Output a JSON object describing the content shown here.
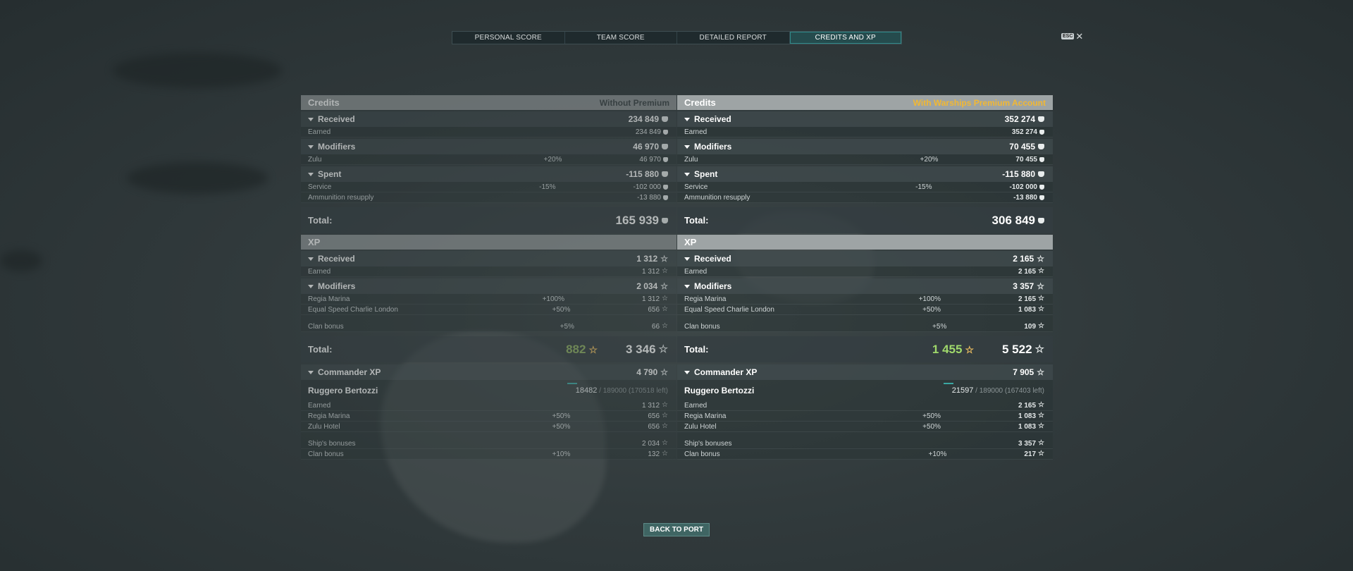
{
  "tabs": [
    "PERSONAL SCORE",
    "TEAM SCORE",
    "DETAILED REPORT",
    "CREDITS AND XP"
  ],
  "esc": {
    "key": "ESC",
    "close": "✕"
  },
  "left": {
    "credits_title": "Credits",
    "credits_note": "Without Premium",
    "received": "Received",
    "received_val": "234 849",
    "earned": "Earned",
    "earned_val": "234 849",
    "modifiers": "Modifiers",
    "modifiers_val": "46 970",
    "zulu": "Zulu",
    "zulu_pct": "+20%",
    "zulu_val": "46 970",
    "spent": "Spent",
    "spent_val": "-115 880",
    "service": "Service",
    "service_pct": "-15%",
    "service_val": "-102 000",
    "ammo": "Ammunition resupply",
    "ammo_val": "-13 880",
    "total_lbl": "Total:",
    "credits_total": "165 939",
    "xp_title": "XP",
    "xp_received": "Received",
    "xp_received_val": "1 312",
    "xp_earned": "Earned",
    "xp_earned_val": "1 312",
    "xp_modifiers": "Modifiers",
    "xp_modifiers_val": "2 034",
    "regia": "Regia Marina",
    "regia_pct": "+100%",
    "regia_val": "1 312",
    "esc_london": "Equal Speed Charlie London",
    "esc_london_pct": "+50%",
    "esc_london_val": "656",
    "clan": "Clan bonus",
    "clan_pct": "+5%",
    "clan_val": "66",
    "xp_total_free": "882",
    "xp_total": "3 346",
    "cmd_title": "Commander XP",
    "cmd_val": "4 790",
    "cmd_name": "Ruggero Bertozzi",
    "cmd_prog": "18482",
    "cmd_prog_rest": " / 189000 (170518 left)",
    "c_earned": "Earned",
    "c_earned_val": "1 312",
    "c_regia": "Regia Marina",
    "c_regia_pct": "+50%",
    "c_regia_val": "656",
    "c_zulu": "Zulu Hotel",
    "c_zulu_pct": "+50%",
    "c_zulu_val": "656",
    "c_ship": "Ship's bonuses",
    "c_ship_val": "2 034",
    "c_clan": "Clan bonus",
    "c_clan_pct": "+10%",
    "c_clan_val": "132"
  },
  "right": {
    "credits_title": "Credits",
    "credits_note": "With Warships Premium Account",
    "received": "Received",
    "received_val": "352 274",
    "earned": "Earned",
    "earned_val": "352 274",
    "modifiers": "Modifiers",
    "modifiers_val": "70 455",
    "zulu": "Zulu",
    "zulu_pct": "+20%",
    "zulu_val": "70 455",
    "spent": "Spent",
    "spent_val": "-115 880",
    "service": "Service",
    "service_pct": "-15%",
    "service_val": "-102 000",
    "ammo": "Ammunition resupply",
    "ammo_val": "-13 880",
    "total_lbl": "Total:",
    "credits_total": "306 849",
    "xp_title": "XP",
    "xp_received": "Received",
    "xp_received_val": "2 165",
    "xp_earned": "Earned",
    "xp_earned_val": "2 165",
    "xp_modifiers": "Modifiers",
    "xp_modifiers_val": "3 357",
    "regia": "Regia Marina",
    "regia_pct": "+100%",
    "regia_val": "2 165",
    "esc_london": "Equal Speed Charlie London",
    "esc_london_pct": "+50%",
    "esc_london_val": "1 083",
    "clan": "Clan bonus",
    "clan_pct": "+5%",
    "clan_val": "109",
    "xp_total_free": "1 455",
    "xp_total": "5 522",
    "cmd_title": "Commander XP",
    "cmd_val": "7 905",
    "cmd_name": "Ruggero Bertozzi",
    "cmd_prog": "21597",
    "cmd_prog_rest": " / 189000 (167403 left)",
    "c_earned": "Earned",
    "c_earned_val": "2 165",
    "c_regia": "Regia Marina",
    "c_regia_pct": "+50%",
    "c_regia_val": "1 083",
    "c_zulu": "Zulu Hotel",
    "c_zulu_pct": "+50%",
    "c_zulu_val": "1 083",
    "c_ship": "Ship's bonuses",
    "c_ship_val": "3 357",
    "c_clan": "Clan bonus",
    "c_clan_pct": "+10%",
    "c_clan_val": "217"
  },
  "back_button": "BACK TO PORT",
  "colors": {
    "active_tab": "#254b4d",
    "premium": "#f2b833",
    "free_xp": "#9fd86b",
    "button": "#3f6563"
  }
}
